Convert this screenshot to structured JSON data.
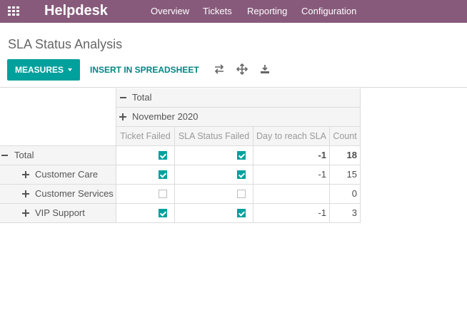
{
  "topbar": {
    "brand": "Helpdesk",
    "menu": [
      "Overview",
      "Tickets",
      "Reporting",
      "Configuration"
    ]
  },
  "control": {
    "title": "SLA Status Analysis",
    "measures_label": "MEASURES",
    "insert_label": "INSERT IN SPREADSHEET",
    "icons": [
      "flip-axis-icon",
      "expand-all-icon",
      "download-icon"
    ]
  },
  "pivot": {
    "col_group_total": "Total",
    "col_group_month": "November 2020",
    "measures": [
      "Ticket Failed",
      "SLA Status Failed",
      "Day to reach SLA",
      "Count"
    ],
    "rows": [
      {
        "label": "Total",
        "ticket_failed": true,
        "sla_failed": true,
        "day": "-1",
        "count": "18"
      },
      {
        "label": "Customer Care",
        "ticket_failed": true,
        "sla_failed": true,
        "day": "-1",
        "count": "15"
      },
      {
        "label": "Customer Services",
        "ticket_failed": false,
        "sla_failed": false,
        "day": "",
        "count": "0"
      },
      {
        "label": "VIP Support",
        "ticket_failed": true,
        "sla_failed": true,
        "day": "-1",
        "count": "3"
      }
    ]
  },
  "colors": {
    "topbar": "#875a7b",
    "primary": "#00a09d",
    "link": "#008784"
  }
}
